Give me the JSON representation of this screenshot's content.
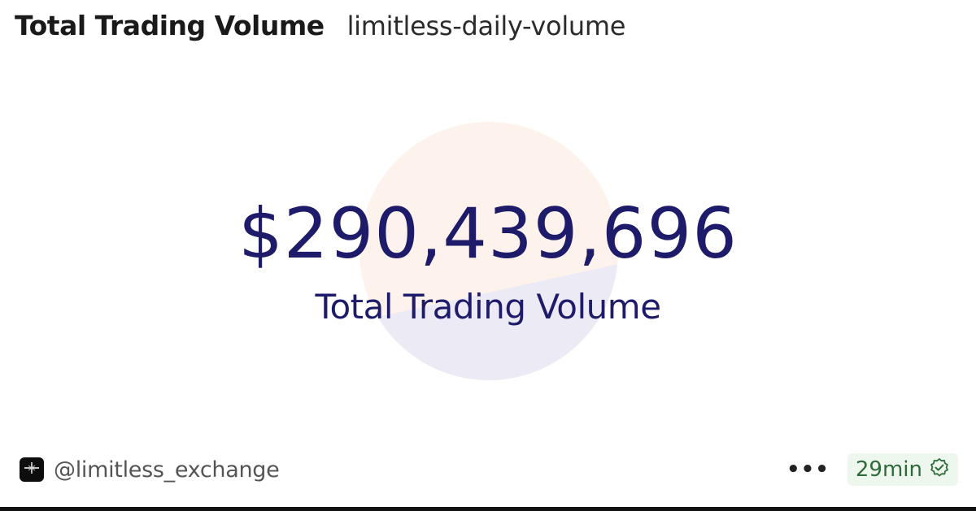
{
  "header": {
    "title": "Total Trading Volume",
    "query_name": "limitless-daily-volume"
  },
  "counter": {
    "value": "$290,439,696",
    "label": "Total Trading Volume",
    "value_color": "#1f1b6b"
  },
  "footer": {
    "author_handle": "@limitless_exchange",
    "avatar_icon": "limitless-logo-icon",
    "more_label": "•••",
    "refresh_time": "29min",
    "refresh_icon": "verified-check-icon",
    "refresh_color": "#2f6b3a"
  },
  "colors": {
    "background_circle_top": "#fdf3ec",
    "background_circle_bottom": "#ecebf5"
  }
}
